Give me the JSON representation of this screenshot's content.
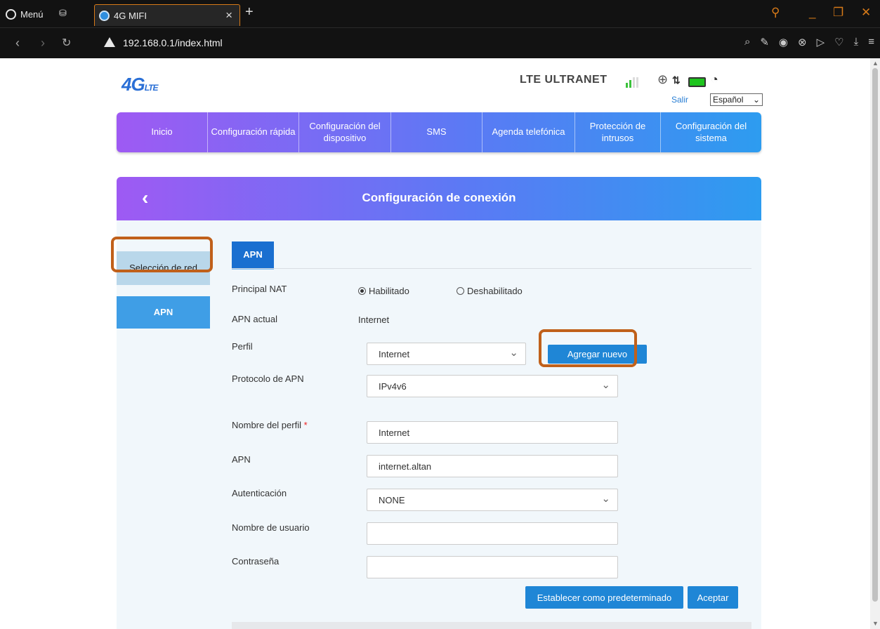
{
  "browser": {
    "menu_label": "Menú",
    "tab_title": "4G MIFI",
    "url": "192.168.0.1/index.html"
  },
  "header": {
    "logo_text": "4G",
    "logo_sub": "LTE",
    "network_name": "LTE ULTRANET",
    "signal_bars": 2,
    "logout": "Salir",
    "language": "Español"
  },
  "nav": {
    "items": [
      "Inicio",
      "Configuración rápida",
      "Configuración del dispositivo",
      "SMS",
      "Agenda telefónica",
      "Protección de intrusos",
      "Configuración del sistema"
    ]
  },
  "panel": {
    "title": "Configuración de conexión",
    "sidebar": [
      "Selección de red",
      "APN"
    ],
    "tab": "APN"
  },
  "form": {
    "nat_label": "Principal NAT",
    "nat_enabled": "Habilitado",
    "nat_disabled": "Deshabilitado",
    "current_apn_label": "APN actual",
    "current_apn": "Internet",
    "profile_label": "Perfil",
    "profile_value": "Internet",
    "add_new": "Agregar nuevo",
    "protocol_label": "Protocolo de APN",
    "protocol_value": "IPv4v6",
    "profile_name_label": "Nombre del perfil",
    "required_mark": "*",
    "profile_name_value": "Internet",
    "apn_label": "APN",
    "apn_value": "internet.altan",
    "auth_label": "Autenticación",
    "auth_value": "NONE",
    "username_label": "Nombre de usuario",
    "username_value": "",
    "password_label": "Contraseña",
    "password_value": "",
    "set_default": "Establecer como predeterminado",
    "accept": "Aceptar"
  }
}
